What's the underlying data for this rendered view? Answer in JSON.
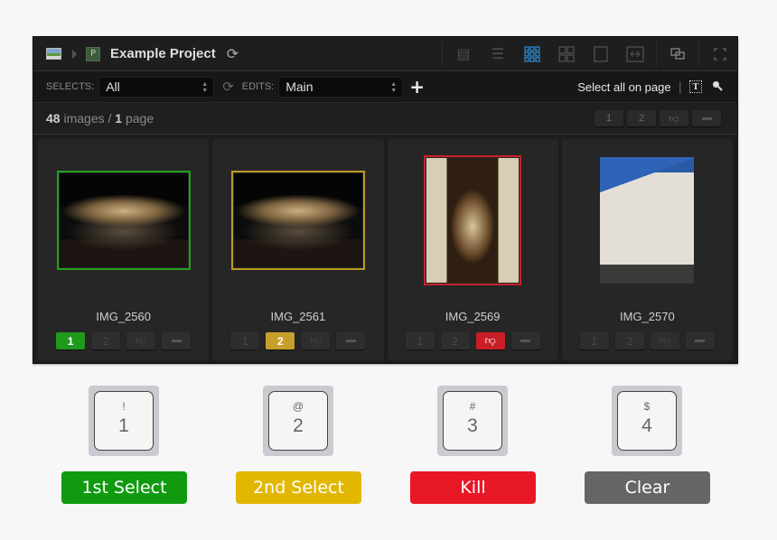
{
  "colors": {
    "select1": "#109a10",
    "select2": "#e2b700",
    "kill": "#e81725",
    "clear": "#666666",
    "active_view": "#2e7fbf"
  },
  "titlebar": {
    "library_icon": "image-icon",
    "project_badge": "P",
    "project_title": "Example Project",
    "refresh_icon": "refresh-icon",
    "view_icons": [
      {
        "name": "detail-view-icon",
        "glyph": "▤",
        "active": false
      },
      {
        "name": "list-view-icon",
        "glyph": "☰",
        "active": false
      },
      {
        "name": "small-grid-view-icon",
        "glyph": "⠿",
        "active": true
      },
      {
        "name": "large-grid-view-icon",
        "glyph": "⊞",
        "active": false
      },
      {
        "name": "single-view-icon",
        "glyph": "☐",
        "active": false
      },
      {
        "name": "compare-view-icon",
        "glyph": "⇔",
        "active": false
      },
      {
        "name": "overlay-icon",
        "glyph": "⧉",
        "active": false
      },
      {
        "name": "fullscreen-icon",
        "glyph": "⤢",
        "active": false
      }
    ]
  },
  "toolbar": {
    "selects_label": "SELECTS:",
    "selects_value": "All",
    "edits_label": "EDITS:",
    "edits_value": "Main",
    "add_label": "+",
    "select_all_label": "Select all on page",
    "separator": "|",
    "text_tool_label": "T"
  },
  "status": {
    "image_count": "48",
    "images_word": "images",
    "slash": "/",
    "page_count": "1",
    "page_word": "page",
    "filters": [
      "1",
      "2",
      "thumbs-down",
      "clear"
    ]
  },
  "images": [
    {
      "name": "IMG_2560",
      "rating": "1st Select",
      "frame": "green",
      "photo": "night-monument"
    },
    {
      "name": "IMG_2561",
      "rating": "2nd Select",
      "frame": "yellow",
      "photo": "night-monument"
    },
    {
      "name": "IMG_2569",
      "rating": "Kill",
      "frame": "red",
      "photo": "archway"
    },
    {
      "name": "IMG_2570",
      "rating": "None",
      "frame": "none",
      "photo": "church-facade"
    }
  ],
  "rating_buttons": [
    "1",
    "2",
    "thumbs-down",
    "clear"
  ],
  "shortcuts": [
    {
      "shift": "!",
      "key": "1",
      "label": "1st Select"
    },
    {
      "shift": "@",
      "key": "2",
      "label": "2nd Select"
    },
    {
      "shift": "#",
      "key": "3",
      "label": "Kill"
    },
    {
      "shift": "$",
      "key": "4",
      "label": "Clear"
    }
  ]
}
